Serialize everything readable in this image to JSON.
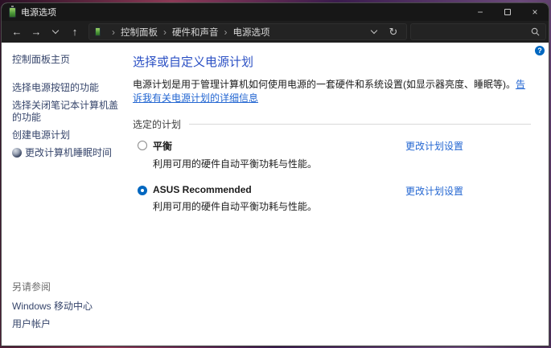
{
  "colors": {
    "accent": "#0067c0",
    "heading": "#2b50c4",
    "link": "#2467d2",
    "sidebar_link": "#36456b",
    "content_bg": "#ffffff"
  },
  "titlebar": {
    "title": "电源选项",
    "minimize_glyph": "−",
    "close_glyph": "×"
  },
  "navbar": {
    "back_glyph": "←",
    "forward_glyph": "→",
    "up_glyph": "↑",
    "refresh_glyph": "↻",
    "breadcrumb": {
      "separator": "›",
      "items": [
        "控制面板",
        "硬件和声音",
        "电源选项"
      ]
    },
    "search": {
      "placeholder": "",
      "value": ""
    }
  },
  "sidebar": {
    "home": "控制面板主页",
    "items": [
      "选择电源按钮的功能",
      "选择关闭笔记本计算机盖的功能",
      "创建电源计划",
      "更改计算机睡眠时间"
    ],
    "see_also": {
      "header": "另请参阅",
      "links": [
        "Windows 移动中心",
        "用户帐户"
      ]
    }
  },
  "main": {
    "heading": "选择或自定义电源计划",
    "description": "电源计划是用于管理计算机如何使用电源的一套硬件和系统设置(如显示器亮度、睡眠等)。",
    "learn_more": "告诉我有关电源计划的详细信息",
    "section_label": "选定的计划",
    "plans": [
      {
        "name": "平衡",
        "description": "利用可用的硬件自动平衡功耗与性能。",
        "selected": false,
        "settings_link": "更改计划设置"
      },
      {
        "name": "ASUS Recommended",
        "description": "利用可用的硬件自动平衡功耗与性能。",
        "selected": true,
        "settings_link": "更改计划设置"
      }
    ],
    "help_glyph": "?"
  }
}
